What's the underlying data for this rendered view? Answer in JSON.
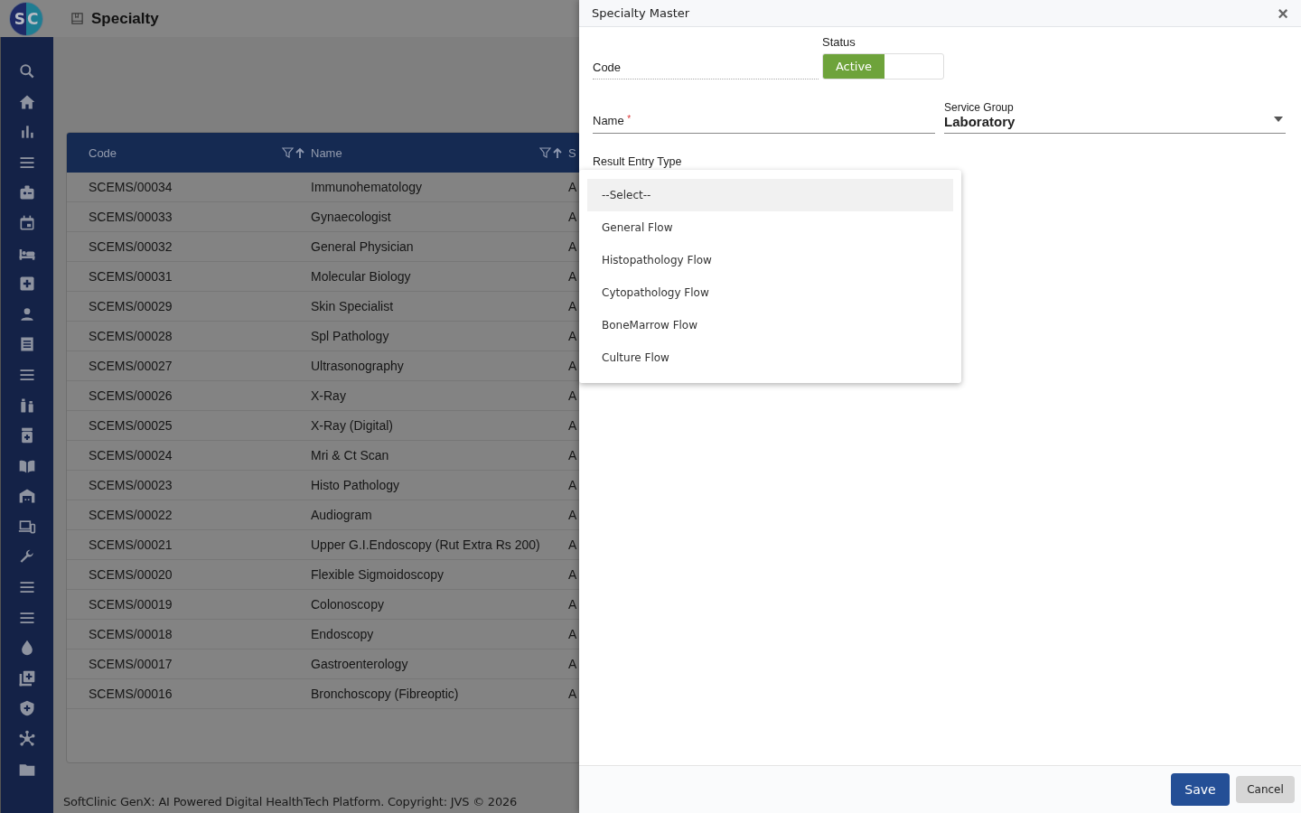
{
  "logo": {
    "letters": [
      "S",
      "C"
    ]
  },
  "page": {
    "title": "Specialty"
  },
  "table": {
    "columns": [
      {
        "label": "Code",
        "filter": true
      },
      {
        "label": "Name",
        "filter": true
      },
      {
        "label": "S",
        "filter": false
      }
    ],
    "rows": [
      {
        "code": "SCEMS/00034",
        "name": "Immunohematology",
        "column_3": "A"
      },
      {
        "code": "SCEMS/00033",
        "name": "Gynaecologist",
        "column_3": "A"
      },
      {
        "code": "SCEMS/00032",
        "name": "General Physician",
        "column_3": "A"
      },
      {
        "code": "SCEMS/00031",
        "name": "Molecular Biology",
        "column_3": "A"
      },
      {
        "code": "SCEMS/00029",
        "name": "Skin Specialist",
        "column_3": "A"
      },
      {
        "code": "SCEMS/00028",
        "name": "Spl Pathology",
        "column_3": "A"
      },
      {
        "code": "SCEMS/00027",
        "name": "Ultrasonography",
        "column_3": "A"
      },
      {
        "code": "SCEMS/00026",
        "name": "X-Ray",
        "column_3": "A"
      },
      {
        "code": "SCEMS/00025",
        "name": "X-Ray (Digital)",
        "column_3": "A"
      },
      {
        "code": "SCEMS/00024",
        "name": "Mri & Ct Scan",
        "column_3": "A"
      },
      {
        "code": "SCEMS/00023",
        "name": "Histo Pathology",
        "column_3": "A"
      },
      {
        "code": "SCEMS/00022",
        "name": "Audiogram",
        "column_3": "A"
      },
      {
        "code": "SCEMS/00021",
        "name": "Upper G.I.Endoscopy (Rut Extra Rs 200)",
        "column_3": "A"
      },
      {
        "code": "SCEMS/00020",
        "name": "Flexible Sigmoidoscopy",
        "column_3": "A"
      },
      {
        "code": "SCEMS/00019",
        "name": "Colonoscopy",
        "column_3": "A"
      },
      {
        "code": "SCEMS/00018",
        "name": "Endoscopy",
        "column_3": "A"
      },
      {
        "code": "SCEMS/00017",
        "name": "Gastroenterology",
        "column_3": "A"
      },
      {
        "code": "SCEMS/00016",
        "name": "Bronchoscopy (Fibreoptic)",
        "column_3": "A"
      }
    ]
  },
  "footer": "SoftClinic GenX: AI Powered Digital HealthTech Platform. Copyright: JVS © 2026",
  "dialog": {
    "title": "Specialty Master",
    "close": "×",
    "code": {
      "label": "Code"
    },
    "status": {
      "label": "Status",
      "active_label": "Active",
      "on": true
    },
    "name": {
      "label": "Name",
      "required": "*"
    },
    "service_group": {
      "label": "Service Group",
      "value": "Laboratory"
    },
    "result_entry_type": {
      "label": "Result Entry Type",
      "expanded": true,
      "options": [
        {
          "label": "--Select--",
          "selected": true
        },
        {
          "label": "General Flow",
          "selected": false
        },
        {
          "label": "Histopathology Flow",
          "selected": false
        },
        {
          "label": "Cytopathology Flow",
          "selected": false
        },
        {
          "label": "BoneMarrow Flow",
          "selected": false
        },
        {
          "label": "Culture Flow",
          "selected": false
        }
      ]
    },
    "buttons": [
      {
        "label": "Save",
        "kind": "primary"
      },
      {
        "label": "Cancel",
        "kind": "secondary"
      }
    ]
  }
}
